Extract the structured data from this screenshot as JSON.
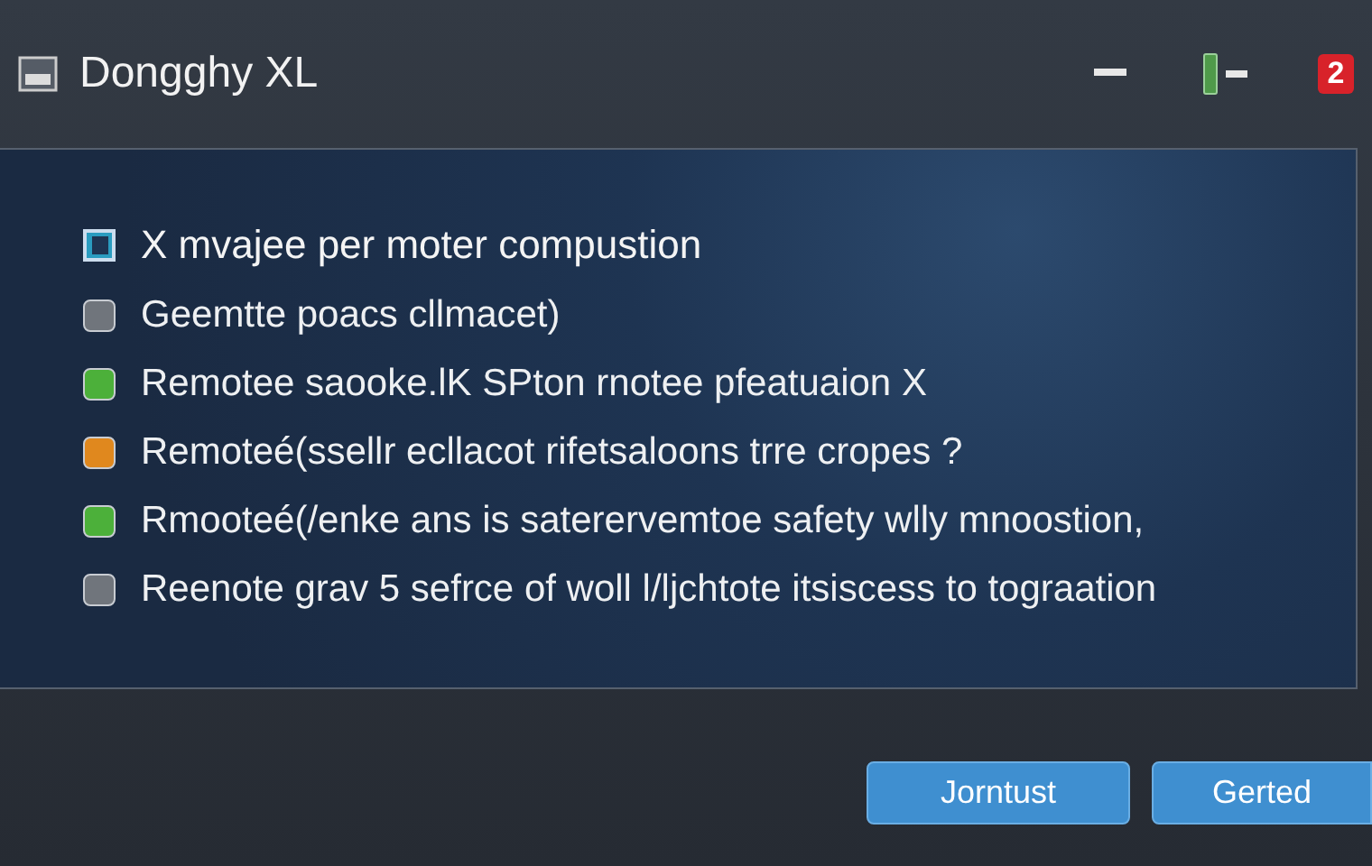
{
  "window": {
    "title": "Dongghy XL",
    "badge": "2"
  },
  "panel": {
    "heading": "X mvajee per moter compustion",
    "items": [
      {
        "text": "Geemtte poacs cllmacet)",
        "color": "#70757c"
      },
      {
        "text": "Remotee saooke.lK SPton rnotee pfeatuaion X",
        "color": "#4cb03a"
      },
      {
        "text": "Remoteé(ssellr ecllacot rifetsaloons trre cropes ?",
        "color": "#e0881e"
      },
      {
        "text": "Rmooteé(/enke ans is saterervemtoe safety wlly mnoostion,",
        "color": "#4cb03a"
      },
      {
        "text": "Reenote grav 5 sefrce of woll l/ljchtote itsiscess to tograation",
        "color": "#70757c"
      }
    ]
  },
  "buttons": [
    "Jorntust",
    "Gerted"
  ]
}
